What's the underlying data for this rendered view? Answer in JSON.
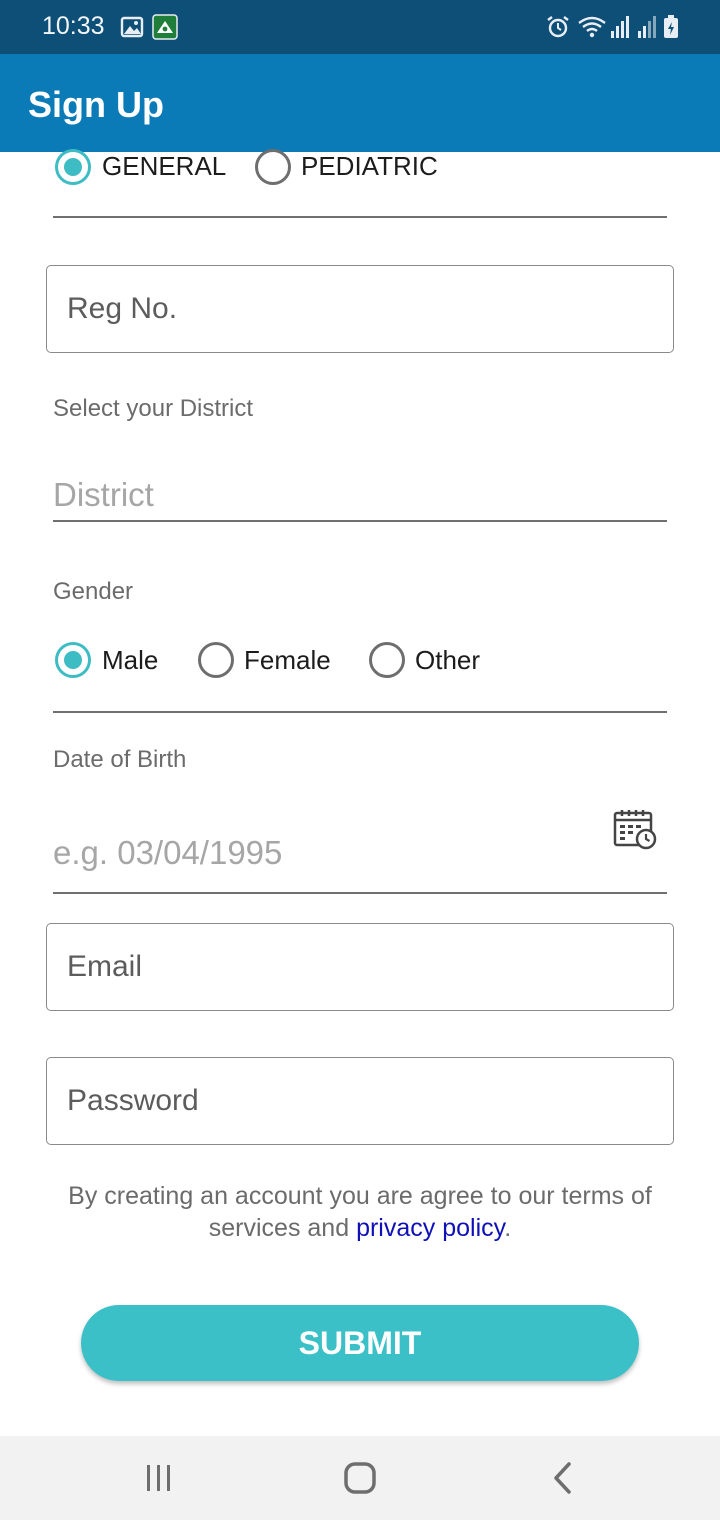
{
  "status_bar": {
    "time": "10:33",
    "icons": [
      "gallery-icon",
      "app-notification-icon",
      "alarm-icon",
      "wifi-icon",
      "signal-icon",
      "signal-icon-2",
      "battery-icon"
    ]
  },
  "app_bar": {
    "title": "Sign Up"
  },
  "category": {
    "options": [
      {
        "label": "GENERAL",
        "checked": true
      },
      {
        "label": "PEDIATRIC",
        "checked": false
      }
    ]
  },
  "reg_no": {
    "placeholder": "Reg No."
  },
  "district": {
    "caption": "Select your District",
    "placeholder": "District"
  },
  "gender": {
    "caption": "Gender",
    "options": [
      {
        "label": "Male",
        "checked": true
      },
      {
        "label": "Female",
        "checked": false
      },
      {
        "label": "Other",
        "checked": false
      }
    ]
  },
  "dob": {
    "caption": "Date of Birth",
    "placeholder": "e.g. 03/04/1995",
    "icon": "calendar-clock-icon"
  },
  "email": {
    "placeholder": "Email"
  },
  "password": {
    "placeholder": "Password"
  },
  "terms": {
    "text": "By creating an account you are agree to our terms of services and",
    "link": "privacy policy",
    "end": "."
  },
  "submit": {
    "label": "SUBMIT"
  },
  "nav_bar": {
    "icons": [
      "recent-apps-icon",
      "home-icon",
      "back-icon"
    ]
  },
  "colors": {
    "status_bar": "#0e4f78",
    "app_bar": "#0a7bb7",
    "accent": "#3dbcc4",
    "link": "#1010b8"
  }
}
